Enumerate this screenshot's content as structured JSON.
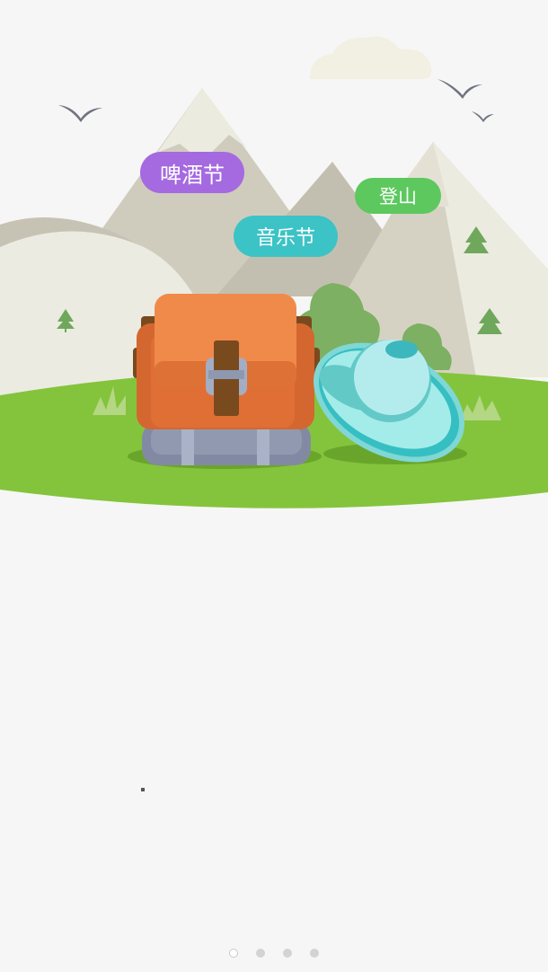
{
  "tags": {
    "beer_festival": "啤酒节",
    "music_festival": "音乐节",
    "hiking": "登山"
  },
  "colors": {
    "background": "#f6f6f6",
    "tag_beer": "#a569e0",
    "tag_music": "#3cc3c6",
    "tag_hiking": "#5cc85e",
    "grass": "#84c43c",
    "backpack": "#e97c41",
    "hat": "#8fe3e0"
  },
  "pager": {
    "pages": 4,
    "current": 1
  },
  "icons": [
    "bird-icon",
    "cloud-icon",
    "mountain-icon",
    "tree-icon",
    "backpack-icon",
    "hat-icon"
  ]
}
